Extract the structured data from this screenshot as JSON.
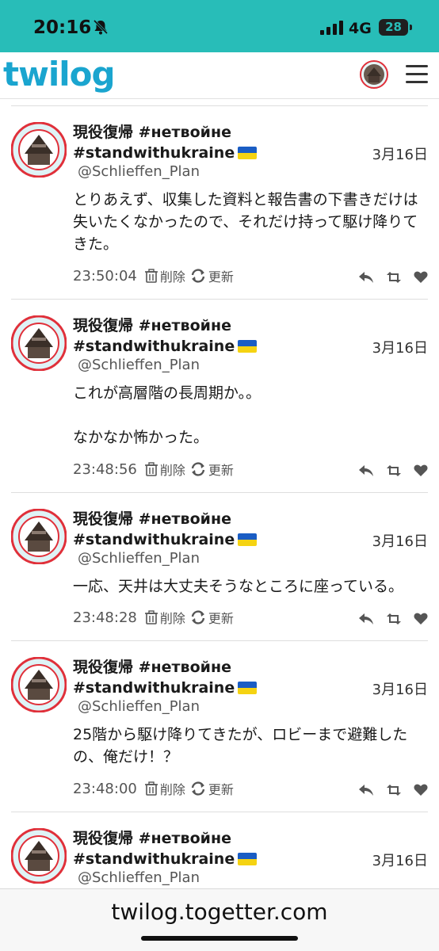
{
  "status_bar": {
    "time": "20:16",
    "network": "4G",
    "battery": "28"
  },
  "header": {
    "logo": "twilog",
    "menu_icon": "hamburger-icon",
    "avatar_icon": "avatar"
  },
  "colors": {
    "status_bar_bg": "#28bdb8",
    "logo": "#1aa5cf",
    "text": "#1a1a1a",
    "muted": "#555555"
  },
  "tweets": [
    {
      "name": "現役復帰 #нетвойне #standwithukraine",
      "handle": "@Schlieffen_Plan",
      "date": "3月16日",
      "body": "とりあえず、収集した資料と報告書の下書きだけは失いたくなかったので、それだけ持って駆け降りてきた。",
      "time": "23:50:04",
      "delete_label": "削除",
      "update_label": "更新"
    },
    {
      "name": "現役復帰 #нетвойне #standwithukraine",
      "handle": "@Schlieffen_Plan",
      "date": "3月16日",
      "body": "これが高層階の長周期か。。\n\nなかなか怖かった。",
      "time": "23:48:56",
      "delete_label": "削除",
      "update_label": "更新"
    },
    {
      "name": "現役復帰 #нетвойне #standwithukraine",
      "handle": "@Schlieffen_Plan",
      "date": "3月16日",
      "body": "一応、天井は大丈夫そうなところに座っている。",
      "time": "23:48:28",
      "delete_label": "削除",
      "update_label": "更新"
    },
    {
      "name": "現役復帰 #нетвойне #standwithukraine",
      "handle": "@Schlieffen_Plan",
      "date": "3月16日",
      "body": "25階から駆け降りてきたが、ロビーまで避難したの、俺だけ！？",
      "time": "23:48:00",
      "delete_label": "削除",
      "update_label": "更新"
    },
    {
      "name": "現役復帰 #нетвойне #standwithukraine",
      "handle": "@Schlieffen_Plan",
      "date": "3月16日",
      "body": "",
      "time": "",
      "delete_label": "",
      "update_label": ""
    }
  ],
  "url_bar": {
    "url": "twilog.togetter.com"
  }
}
